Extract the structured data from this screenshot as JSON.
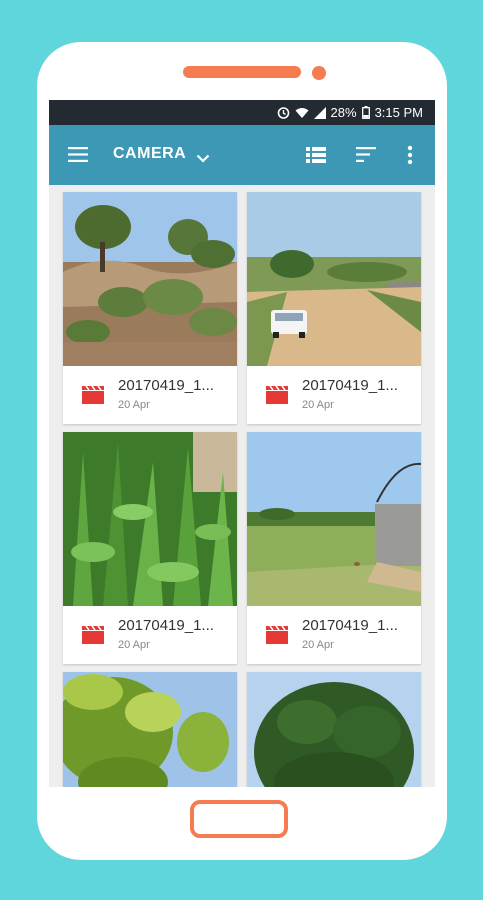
{
  "status": {
    "battery": "28%",
    "time": "3:15 PM"
  },
  "appbar": {
    "title": "CAMERA"
  },
  "colors": {
    "accent": "#3d98b6",
    "background": "#5fd6dc",
    "device_accent": "#f47c50",
    "video_icon": "#e53935"
  },
  "items": [
    {
      "name": "20170419_1...",
      "date": "20 Apr"
    },
    {
      "name": "20170419_1...",
      "date": "20 Apr"
    },
    {
      "name": "20170419_1...",
      "date": "20 Apr"
    },
    {
      "name": "20170419_1...",
      "date": "20 Apr"
    },
    {
      "name": "",
      "date": ""
    },
    {
      "name": "",
      "date": ""
    }
  ]
}
